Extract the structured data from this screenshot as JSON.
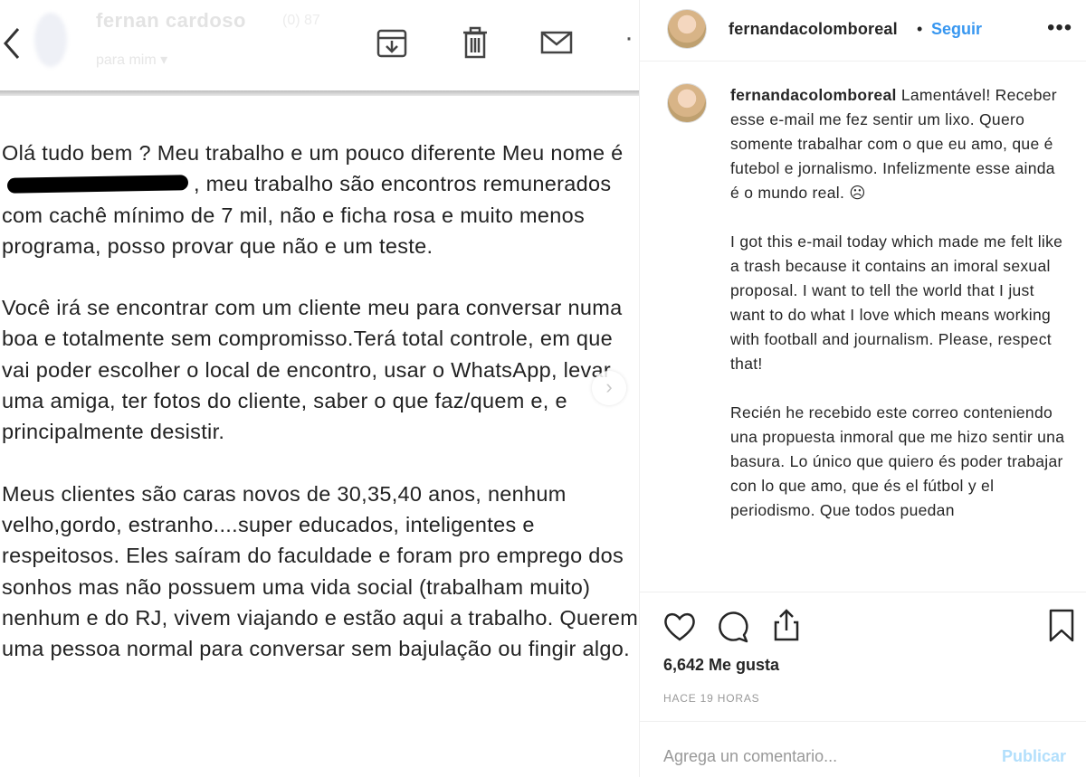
{
  "email": {
    "sender": "fernan cardoso",
    "sender_meta": "(0) 87",
    "recipient": "para mim ▾",
    "paragraphs": [
      {
        "before": "Olá tudo bem ? Meu trabalho e um pouco diferente Meu nome é",
        "after": ", meu trabalho são encontros remunerados com cachê mínimo de 7 mil, não e ficha rosa e muito menos programa, posso provar que não e um teste."
      },
      {
        "before": "Você irá se encontrar com um cliente meu para conversar numa boa e totalmente sem compromisso.Terá total controle, em que vai poder escolher o local de encontro, usar o WhatsApp, levar uma amiga, ter fotos do cliente, saber o que faz/quem e, e principalmente desistir.",
        "after": ""
      },
      {
        "before": "Meus clientes são caras novos de 30,35,40 anos, nenhum velho,gordo, estranho....super educados, inteligentes e respeitosos. Eles saíram do faculdade e foram pro emprego dos sonhos mas não possuem uma vida social (trabalham muito) nenhum e do RJ, vivem viajando e estão aqui a trabalho. Querem   uma pessoa normal para conversar sem bajulação ou fingir algo.",
        "after": ""
      }
    ],
    "toolbar_icons": [
      "back-arrow-icon",
      "archive-icon",
      "trash-icon",
      "mail-icon",
      "more-icon"
    ],
    "carousel_next": "›"
  },
  "instagram": {
    "username": "fernandacolomboreal",
    "separator": "•",
    "follow_label": "Seguir",
    "options_label": "•••",
    "caption": {
      "username": "fernandacolomboreal",
      "paragraphs": [
        "Lamentável! Receber esse e-mail me fez sentir um lixo. Quero somente trabalhar com o que eu amo, que é futebol e jornalismo. Infelizmente esse ainda é o mundo real. ☹",
        "I got this e-mail today which made me felt like a trash because it contains an imoral sexual proposal. I want to tell the world that I just want to do what I love which means working with football and journalism. Please, respect that!",
        "Recién he recebido este correo conteniendo una propuesta inmoral que me hizo sentir una basura. Lo único que quiero és poder trabajar con lo que amo, que és el fútbol y el periodismo. Que todos puedan"
      ]
    },
    "likes": "6,642 Me gusta",
    "timestamp": "HACE 19 HORAS",
    "comment_placeholder": "Agrega un comentario...",
    "post_label": "Publicar",
    "action_icons": [
      "heart-icon",
      "comment-icon",
      "share-icon",
      "bookmark-icon"
    ]
  }
}
